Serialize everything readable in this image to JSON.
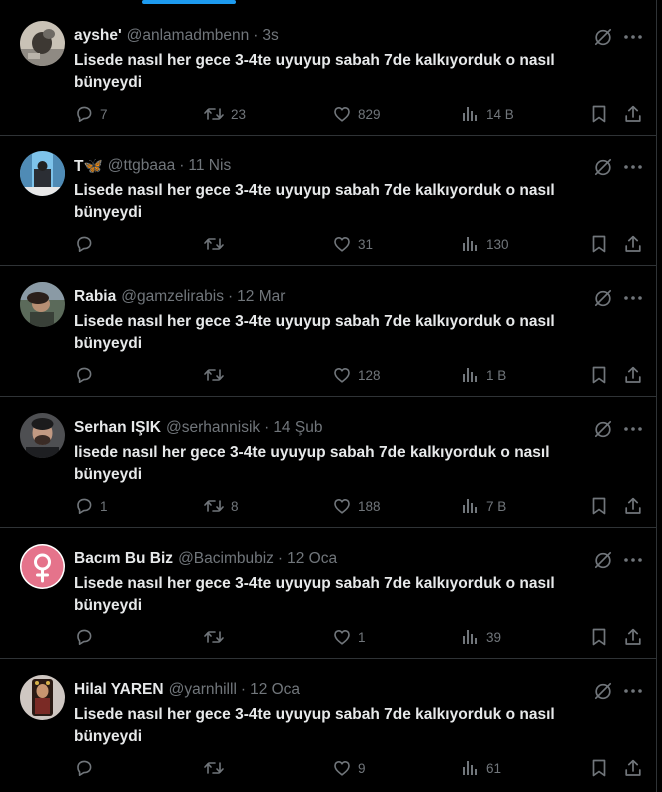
{
  "tweets": [
    {
      "display_name": "ayshe'",
      "handle": "@anlamadmbenn",
      "separator": "·",
      "time": "3s",
      "text": "Lisede nasıl her gece 3-4te uyuyup sabah 7de kalkıyorduk o nasıl\nbünyeydi",
      "replies": "7",
      "retweets": "23",
      "likes": "829",
      "views": "14 B"
    },
    {
      "display_name": "T🦋",
      "handle": "@ttgbaaa",
      "separator": "·",
      "time": "11 Nis",
      "text": "Lisede nasıl her gece 3-4te uyuyup sabah 7de kalkıyorduk o nasıl\nbünyeydi",
      "replies": "",
      "retweets": "",
      "likes": "31",
      "views": "130"
    },
    {
      "display_name": "Rabia",
      "handle": "@gamzelirabis",
      "separator": "·",
      "time": "12 Mar",
      "text": "Lisede nasıl her gece 3-4te uyuyup sabah 7de kalkıyorduk o nasıl\nbünyeydi",
      "replies": "",
      "retweets": "",
      "likes": "128",
      "views": "1 B"
    },
    {
      "display_name": "Serhan IŞIK",
      "handle": "@serhannisik",
      "separator": "·",
      "time": "14 Şub",
      "text": "lisede nasıl her gece 3-4te uyuyup sabah 7de kalkıyorduk o nasıl\nbünyeydi",
      "replies": "1",
      "retweets": "8",
      "likes": "188",
      "views": "7 B"
    },
    {
      "display_name": "Bacım Bu Biz",
      "handle": "@Bacimbubiz",
      "separator": "·",
      "time": "12 Oca",
      "text": "Lisede nasıl her gece 3-4te uyuyup sabah 7de kalkıyorduk o nasıl\nbünyeydi",
      "replies": "",
      "retweets": "",
      "likes": "1",
      "views": "39"
    },
    {
      "display_name": "Hilal YAREN",
      "handle": "@yarnhilll",
      "separator": "·",
      "time": "12 Oca",
      "text": "Lisede nasıl her gece 3-4te uyuyup sabah 7de kalkıyorduk o nasıl\nbünyeydi",
      "replies": "",
      "retweets": "",
      "likes": "9",
      "views": "61"
    }
  ],
  "icons": {
    "reply": "reply-icon",
    "retweet": "retweet-icon",
    "like": "heart-icon",
    "views": "views-icon",
    "bookmark": "bookmark-icon",
    "share": "share-icon",
    "grok": "grok-icon",
    "more": "more-icon"
  },
  "colors": {
    "background": "#000000",
    "text_primary": "#e7e9ea",
    "text_secondary": "#71767b",
    "border": "#2f3336",
    "accent": "#1d9bf0",
    "venus_avatar": "#e5738b"
  }
}
